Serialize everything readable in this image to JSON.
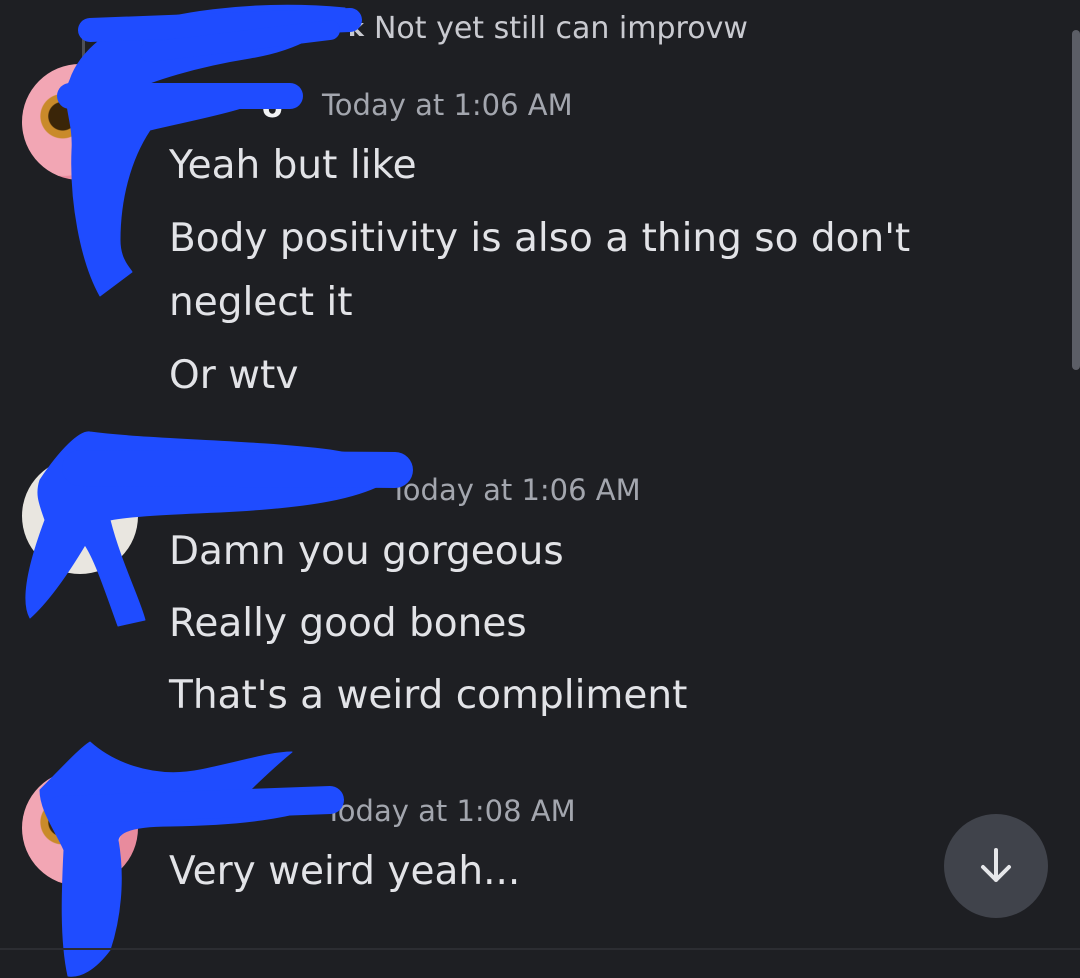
{
  "reply_preview": {
    "text": "Not yet still can improvw"
  },
  "messages": [
    {
      "username": "o",
      "timestamp": "Today at 1:06 AM",
      "lines": [
        "Yeah but like",
        "Body positivity is also a thing so don't",
        "neglect it",
        "Or wtv"
      ]
    },
    {
      "username": "",
      "timestamp": "Today at 1:06 AM",
      "lines": [
        "Damn you gorgeous",
        "Really good bones",
        "That's a weird compliment"
      ]
    },
    {
      "username": "",
      "timestamp": "Today at 1:08 AM",
      "lines": [
        "Very weird yeah..."
      ]
    }
  ],
  "colors": {
    "background": "#1e1f23",
    "redaction": "#1f4cff",
    "button": "#40434b"
  },
  "icons": {
    "scroll_to_bottom": "arrow-down-icon"
  }
}
